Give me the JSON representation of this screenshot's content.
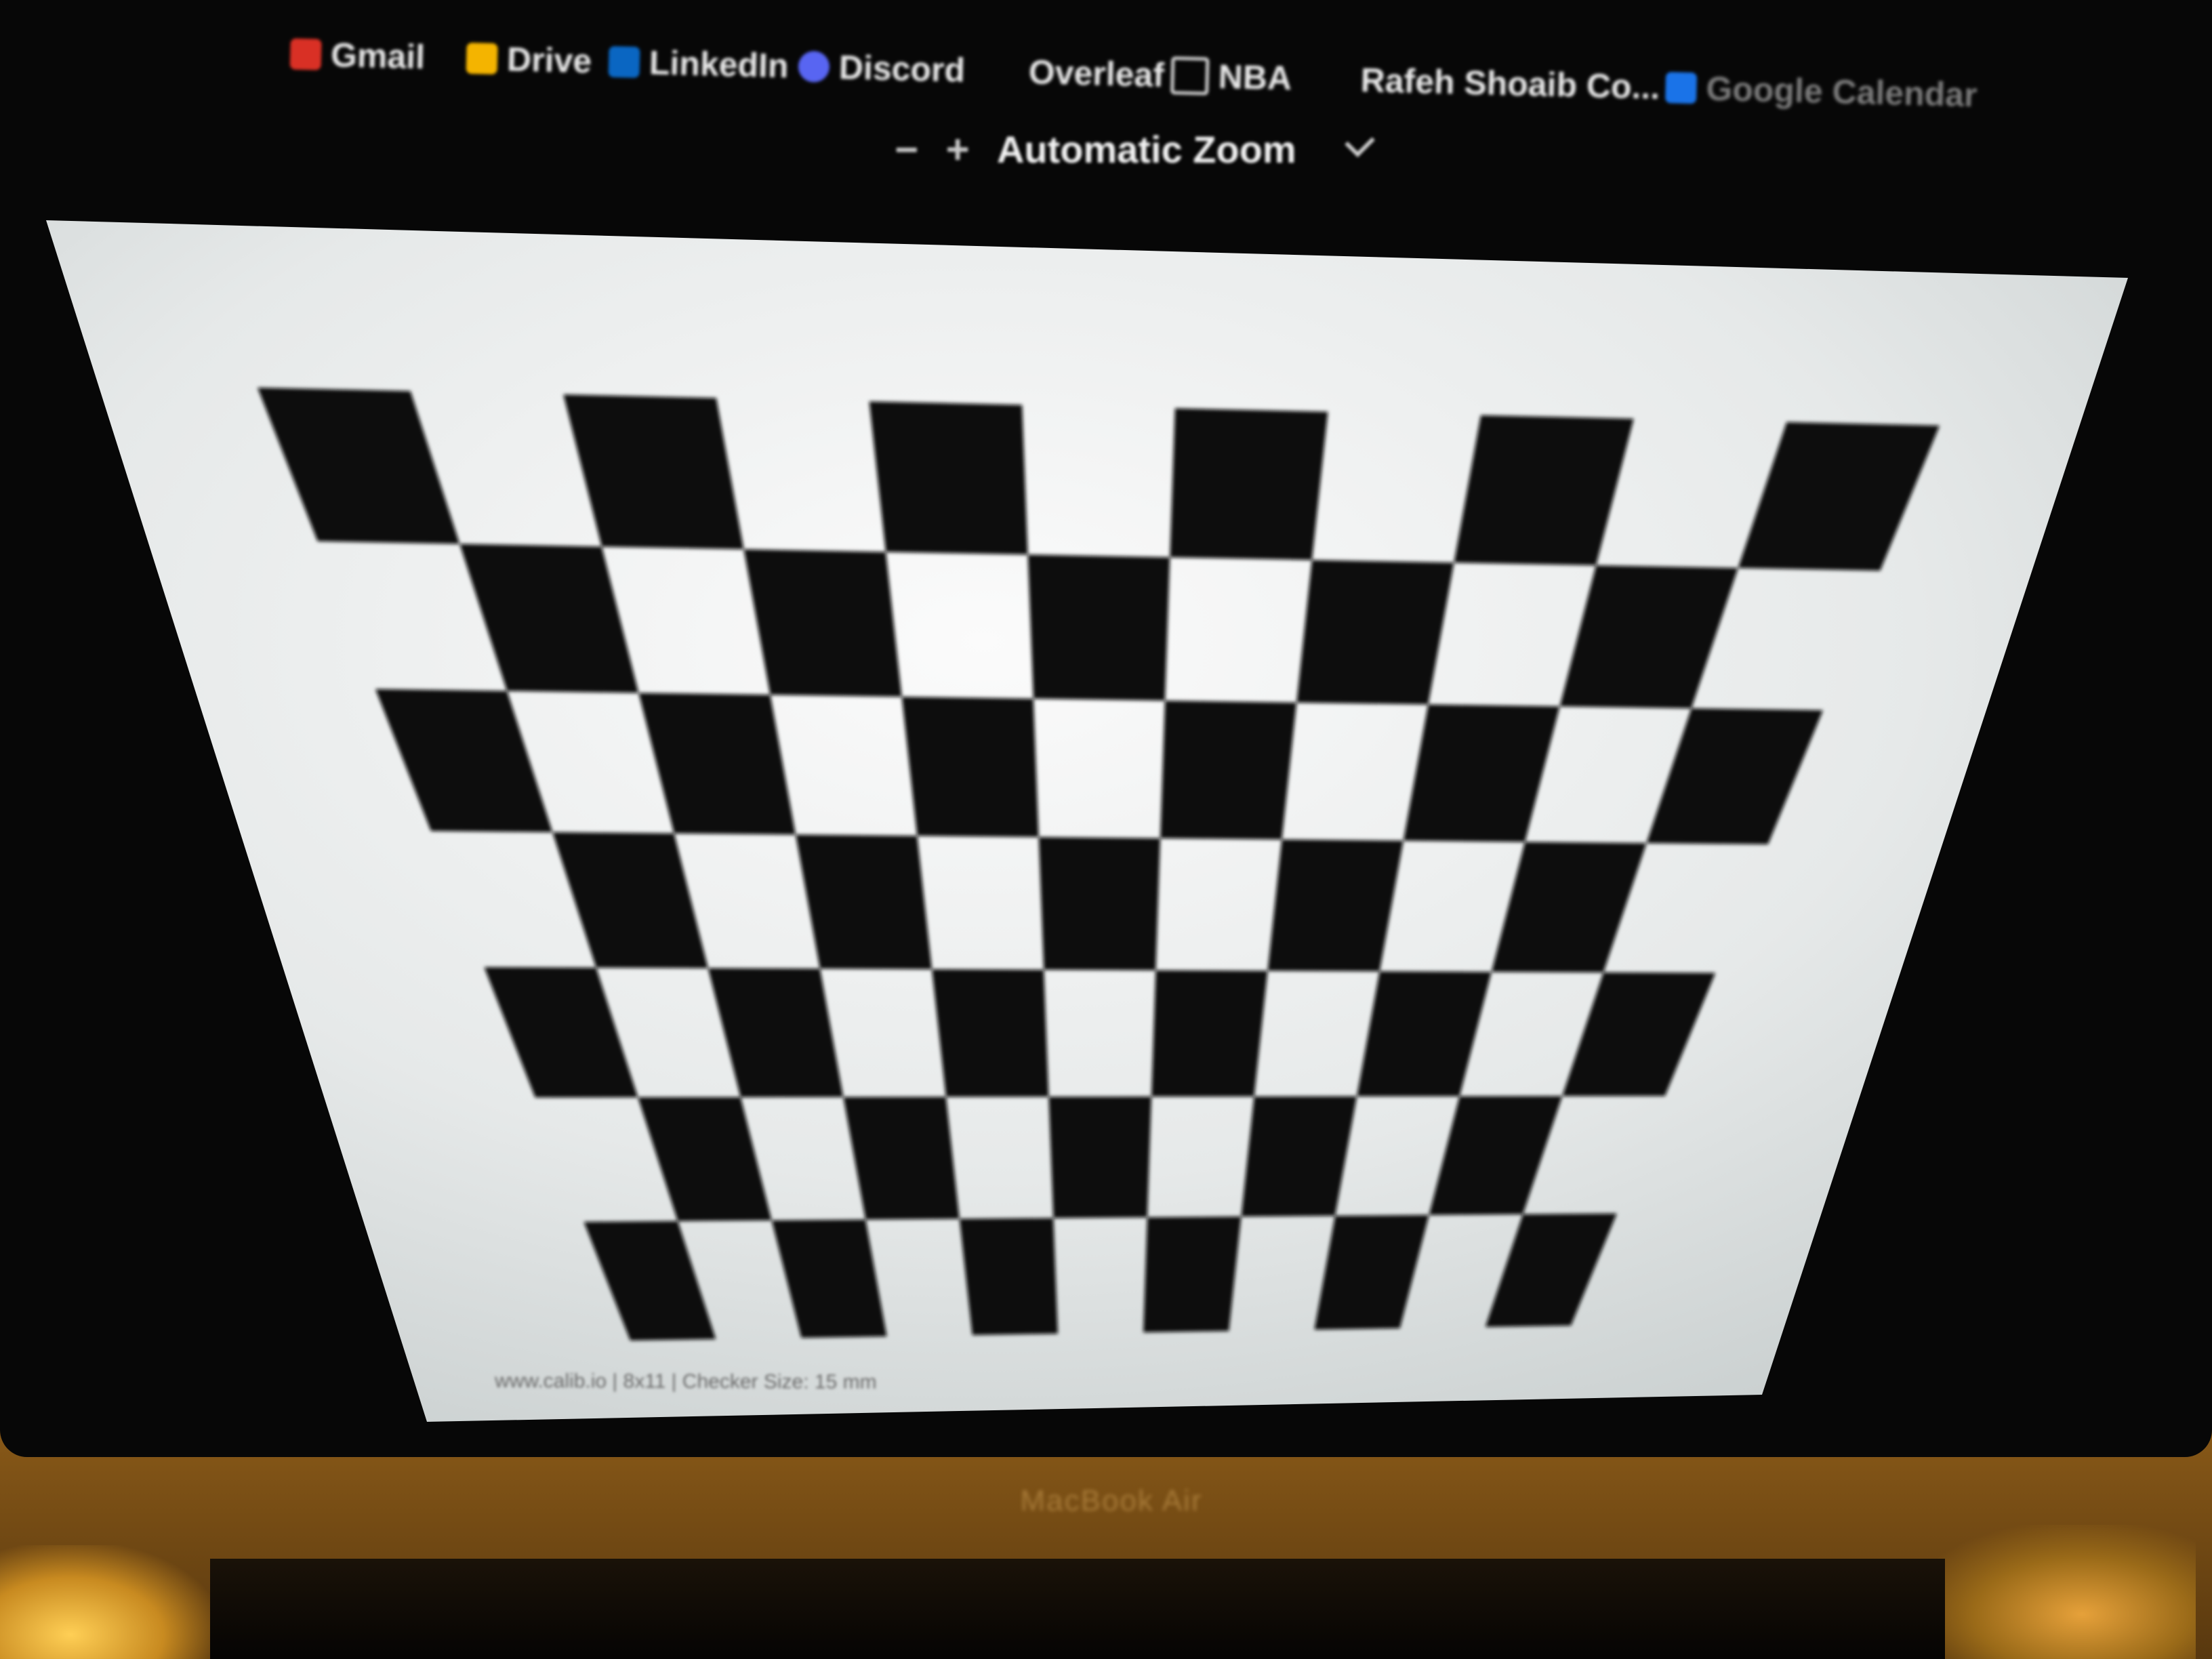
{
  "browser": {
    "bookmarks": [
      {
        "label": "Gmail",
        "icon": "gmail-icon",
        "color": "#d93025"
      },
      {
        "label": "Drive",
        "icon": "drive-icon",
        "color": "#f4b400"
      },
      {
        "label": "LinkedIn",
        "icon": "linkedin-icon",
        "color": "#0a66c2"
      },
      {
        "label": "Discord",
        "icon": "discord-icon",
        "color": "#5865f2"
      },
      {
        "label": "Overleaf",
        "icon": "",
        "color": ""
      },
      {
        "label": "NBA",
        "icon": "folder-icon",
        "color": "#9aa0a6"
      },
      {
        "label": "Rafeh Shoaib Co...",
        "icon": "",
        "color": ""
      },
      {
        "label": "Google Calendar",
        "icon": "calendar-icon",
        "color": "#1a73e8"
      }
    ]
  },
  "pdf_viewer": {
    "zoom_out_label": "−",
    "zoom_in_label": "+",
    "zoom_value": "Automatic Zoom"
  },
  "document": {
    "pattern": "checkerboard",
    "rows": 7,
    "columns": 11,
    "footer_text": "www.calib.io | 8x11 | Checker Size: 15 mm",
    "colors": {
      "dark": "#0a0a0a",
      "light": "#e9ecec"
    }
  },
  "device": {
    "brand_label": "MacBook Air"
  }
}
